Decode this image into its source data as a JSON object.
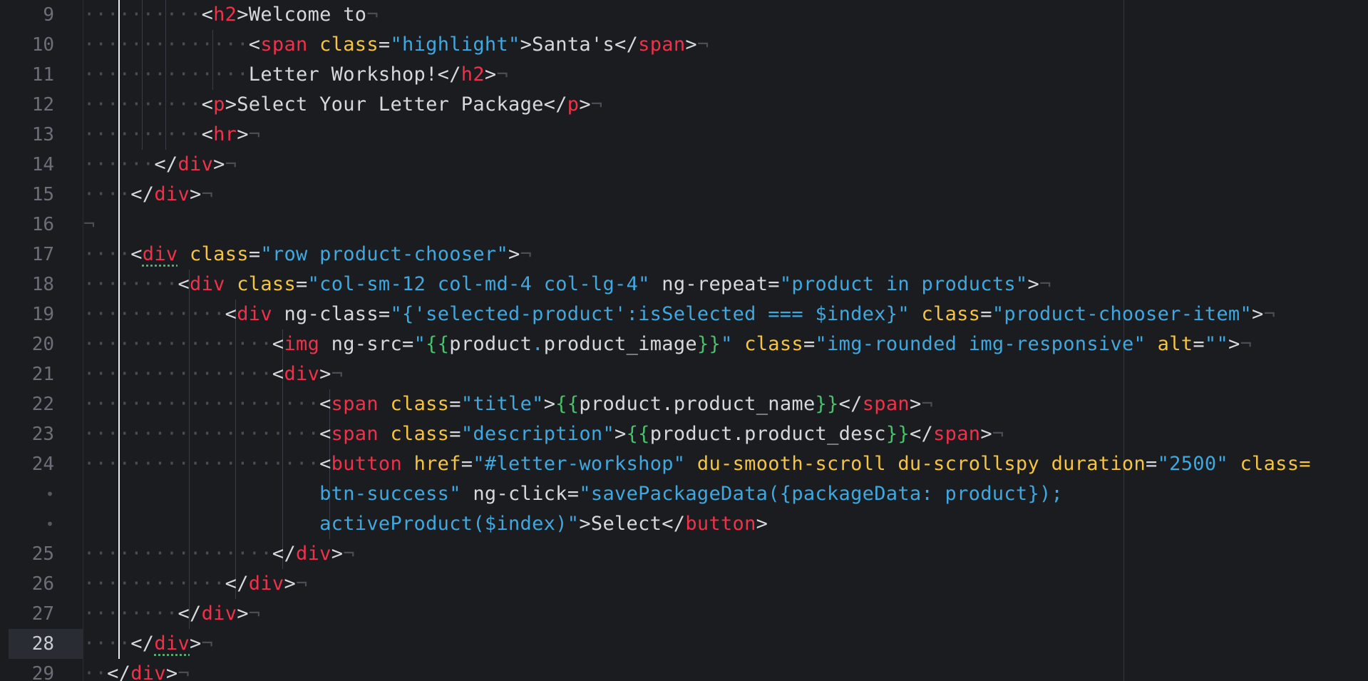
{
  "editor": {
    "active_line": "28",
    "gutter": [
      {
        "num": "9"
      },
      {
        "num": "10"
      },
      {
        "num": "11"
      },
      {
        "num": "12"
      },
      {
        "num": "13"
      },
      {
        "num": "14"
      },
      {
        "num": "15"
      },
      {
        "num": "16"
      },
      {
        "num": "17"
      },
      {
        "num": "18"
      },
      {
        "num": "19"
      },
      {
        "num": "20"
      },
      {
        "num": "21"
      },
      {
        "num": "22"
      },
      {
        "num": "23"
      },
      {
        "num": "24"
      },
      {
        "num": "•"
      },
      {
        "num": "•"
      },
      {
        "num": "25"
      },
      {
        "num": "26"
      },
      {
        "num": "27"
      },
      {
        "num": "28"
      },
      {
        "num": "29"
      }
    ],
    "lines": [
      {
        "ws": "··········",
        "tokens": [
          [
            "p",
            "<"
          ],
          [
            "t",
            "h2"
          ],
          [
            "p",
            ">Welcome to"
          ]
        ]
      },
      {
        "ws": "··············",
        "tokens": [
          [
            "p",
            "<"
          ],
          [
            "t",
            "span"
          ],
          [
            "a",
            " class"
          ],
          [
            "p",
            "="
          ],
          [
            "s",
            "\"highlight\""
          ],
          [
            "p",
            ">Santa's</"
          ],
          [
            "t",
            "span"
          ],
          [
            "p",
            ">"
          ]
        ]
      },
      {
        "ws": "··············",
        "tokens": [
          [
            "p",
            "Letter Workshop!</"
          ],
          [
            "t",
            "h2"
          ],
          [
            "p",
            ">"
          ]
        ]
      },
      {
        "ws": "··········",
        "tokens": [
          [
            "p",
            "<"
          ],
          [
            "t",
            "p"
          ],
          [
            "p",
            ">Select Your Letter Package</"
          ],
          [
            "t",
            "p"
          ],
          [
            "p",
            ">"
          ]
        ]
      },
      {
        "ws": "··········",
        "tokens": [
          [
            "p",
            "<"
          ],
          [
            "t",
            "hr"
          ],
          [
            "p",
            ">"
          ]
        ]
      },
      {
        "ws": "······",
        "tokens": [
          [
            "p",
            "</"
          ],
          [
            "t",
            "div"
          ],
          [
            "p",
            ">"
          ]
        ]
      },
      {
        "ws": "····",
        "tokens": [
          [
            "p",
            "</"
          ],
          [
            "t",
            "div"
          ],
          [
            "p",
            ">"
          ]
        ]
      },
      {
        "ws": "",
        "tokens": []
      },
      {
        "ws": "····",
        "tokens": [
          [
            "p",
            "<"
          ],
          [
            "tu",
            "div"
          ],
          [
            "a",
            " class"
          ],
          [
            "p",
            "="
          ],
          [
            "s",
            "\"row product-chooser\""
          ],
          [
            "p",
            ">"
          ]
        ]
      },
      {
        "ws": "········",
        "tokens": [
          [
            "p",
            "<"
          ],
          [
            "t",
            "div"
          ],
          [
            "a",
            " class"
          ],
          [
            "p",
            "="
          ],
          [
            "s",
            "\"col-sm-12 col-md-4 col-lg-4\""
          ],
          [
            "a2",
            " ng-repeat"
          ],
          [
            "p",
            "="
          ],
          [
            "s",
            "\"product in products\""
          ],
          [
            "p",
            ">"
          ]
        ]
      },
      {
        "ws": "············",
        "tokens": [
          [
            "p",
            "<"
          ],
          [
            "t",
            "div"
          ],
          [
            "a2",
            " ng-class"
          ],
          [
            "p",
            "="
          ],
          [
            "s",
            "\"{'selected-product':isSelected === $index}\""
          ],
          [
            "a",
            " class"
          ],
          [
            "p",
            "="
          ],
          [
            "s",
            "\"product-chooser-item\""
          ],
          [
            "p",
            ">"
          ]
        ]
      },
      {
        "ws": "················",
        "tokens": [
          [
            "p",
            "<"
          ],
          [
            "t",
            "img"
          ],
          [
            "a2",
            " ng-src"
          ],
          [
            "p",
            "="
          ],
          [
            "s",
            "\""
          ],
          [
            "g",
            "{{"
          ],
          [
            "p",
            "product"
          ],
          [
            "s",
            "."
          ],
          [
            "p",
            "product_image"
          ],
          [
            "g",
            "}}"
          ],
          [
            "s",
            "\""
          ],
          [
            "a",
            " class"
          ],
          [
            "p",
            "="
          ],
          [
            "s",
            "\"img-rounded img-responsive\""
          ],
          [
            "a",
            " alt"
          ],
          [
            "p",
            "="
          ],
          [
            "s",
            "\"\""
          ],
          [
            "p",
            ">"
          ]
        ]
      },
      {
        "ws": "················",
        "tokens": [
          [
            "p",
            "<"
          ],
          [
            "t",
            "div"
          ],
          [
            "p",
            ">"
          ]
        ]
      },
      {
        "ws": "····················",
        "tokens": [
          [
            "p",
            "<"
          ],
          [
            "t",
            "span"
          ],
          [
            "a",
            " class"
          ],
          [
            "p",
            "="
          ],
          [
            "s",
            "\"title\""
          ],
          [
            "p",
            ">"
          ],
          [
            "g",
            "{{"
          ],
          [
            "p",
            "product.product_name"
          ],
          [
            "g",
            "}}"
          ],
          [
            "p",
            "</"
          ],
          [
            "t",
            "span"
          ],
          [
            "p",
            ">"
          ]
        ]
      },
      {
        "ws": "····················",
        "tokens": [
          [
            "p",
            "<"
          ],
          [
            "t",
            "span"
          ],
          [
            "a",
            " class"
          ],
          [
            "p",
            "="
          ],
          [
            "s",
            "\"description\""
          ],
          [
            "p",
            ">"
          ],
          [
            "g",
            "{{"
          ],
          [
            "p",
            "product.product_desc"
          ],
          [
            "g",
            "}}"
          ],
          [
            "p",
            "</"
          ],
          [
            "t",
            "span"
          ],
          [
            "p",
            ">"
          ]
        ]
      },
      {
        "ws": "····················",
        "tokens": [
          [
            "p",
            "<"
          ],
          [
            "t",
            "button"
          ],
          [
            "a",
            " href"
          ],
          [
            "p",
            "="
          ],
          [
            "s",
            "\"#letter-workshop\""
          ],
          [
            "a",
            " du-smooth-scroll du-scrollspy duration"
          ],
          [
            "p",
            "="
          ],
          [
            "s",
            "\"2500\""
          ],
          [
            "a",
            " class="
          ]
        ]
      },
      {
        "ws": "                    ",
        "tokens": [
          [
            "s",
            "btn-success\""
          ],
          [
            "a2",
            " ng-click"
          ],
          [
            "p",
            "="
          ],
          [
            "s",
            "\"savePackageData({packageData: product});"
          ]
        ]
      },
      {
        "ws": "                    ",
        "tokens": [
          [
            "s",
            "activeProduct($index)\""
          ],
          [
            "p",
            ">Select</"
          ],
          [
            "t",
            "button"
          ],
          [
            "p",
            ">"
          ]
        ]
      },
      {
        "ws": "················",
        "tokens": [
          [
            "p",
            "</"
          ],
          [
            "t",
            "div"
          ],
          [
            "p",
            ">"
          ]
        ]
      },
      {
        "ws": "············",
        "tokens": [
          [
            "p",
            "</"
          ],
          [
            "t",
            "div"
          ],
          [
            "p",
            ">"
          ]
        ]
      },
      {
        "ws": "········",
        "tokens": [
          [
            "p",
            "</"
          ],
          [
            "t",
            "div"
          ],
          [
            "p",
            ">"
          ]
        ]
      },
      {
        "ws": "····",
        "tokens": [
          [
            "p",
            "</"
          ],
          [
            "tu",
            "div"
          ],
          [
            "p",
            ">"
          ]
        ]
      },
      {
        "ws": "··",
        "tokens": [
          [
            "p",
            "</"
          ],
          [
            "t",
            "div"
          ],
          [
            "p",
            ">"
          ]
        ]
      }
    ],
    "eol_marker": "¬",
    "colors": {
      "background": "#1b1c20",
      "tag": "#f0314a",
      "attribute": "#f5c542",
      "string": "#3fa8df",
      "interpolation": "#49c06a",
      "text": "#d6d8dd",
      "line_number": "#6b6f78"
    }
  }
}
